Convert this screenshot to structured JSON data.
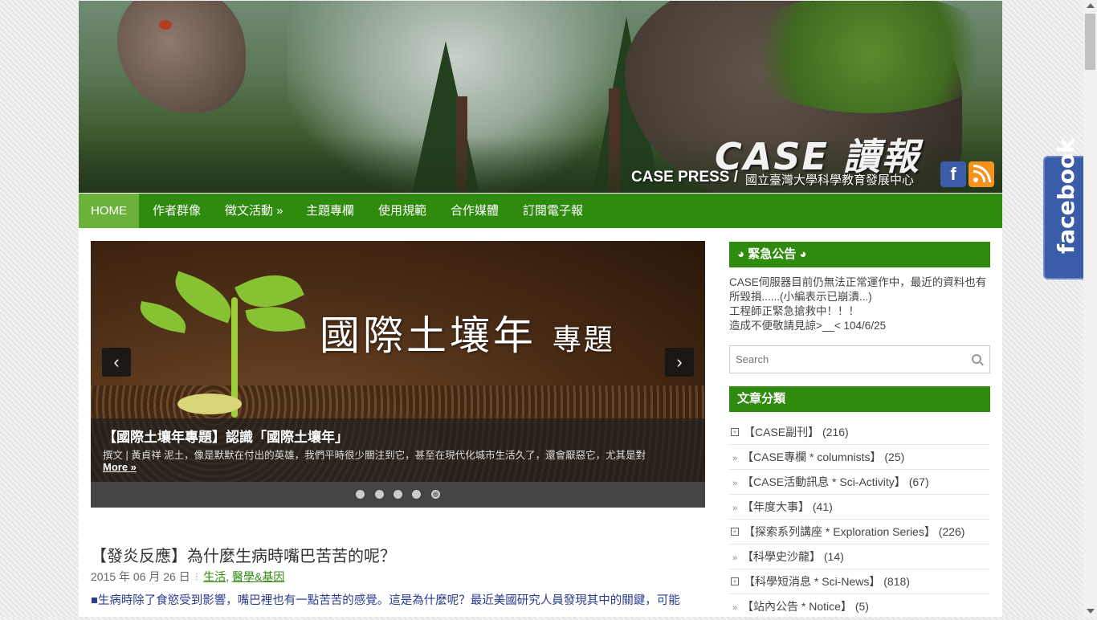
{
  "header": {
    "logo_main": "CASE 讀報",
    "logo_sub": "CASE PRESS /",
    "logo_org": "國立臺灣大學科學教育發展中心",
    "facebook_glyph": "f",
    "icons": [
      "facebook-icon",
      "rss-icon"
    ]
  },
  "nav": {
    "items": [
      {
        "label": "HOME"
      },
      {
        "label": "作者群像"
      },
      {
        "label": "徵文活動 »"
      },
      {
        "label": "主題專欄"
      },
      {
        "label": "使用規範"
      },
      {
        "label": "合作媒體"
      },
      {
        "label": "訂閱電子報"
      }
    ]
  },
  "slider": {
    "banner_text": "國際土壤年",
    "banner_text_small": "專題",
    "prev": "‹",
    "next": "›",
    "caption_title": "【國際土壤年專題】認識「國際土壤年」",
    "caption_text": "撰文 | 黃貞祥 泥土，像是默默在付出的英雄，我們平時很少關注到它，甚至在現代化城市生活久了，還會厭惡它，尤其是對",
    "more": "More »",
    "dots": 5
  },
  "post": {
    "title": "【發炎反應】為什麼生病時嘴巴苦苦的呢？",
    "date": "2015 年 06 月 26 日",
    "cat1": "生活",
    "cat2": "醫學&基因",
    "excerpt": "■生病時除了食慾受到影響，嘴巴裡也有一點苦苦的感覺。這是為什麼呢？最近美國研究人員發現其中的關鍵，可能"
  },
  "sidebar": {
    "notice_title": "◕ 緊急公告 ◕",
    "notice_lines": [
      "CASE伺服器目前仍無法正常運作中，最近的資料也有所毀損......(小編表示已崩潰...)",
      "工程師正緊急搶救中！！！",
      "造成不便敬請見諒>__< 104/6/25"
    ],
    "search_placeholder": "Search",
    "categories_title": "文章分類",
    "categories": [
      {
        "label": "【CASE副刊】",
        "count": "(216)",
        "expandable": true
      },
      {
        "label": "【CASE專欄 * columnists】",
        "count": "(25)",
        "expandable": false
      },
      {
        "label": "【CASE活動訊息 * Sci-Activity】",
        "count": "(67)",
        "expandable": false
      },
      {
        "label": "【年度大事】",
        "count": "(41)",
        "expandable": false
      },
      {
        "label": "【探索系列講座 * Exploration Series】",
        "count": "(226)",
        "expandable": true
      },
      {
        "label": "【科學史沙龍】",
        "count": "(14)",
        "expandable": false
      },
      {
        "label": "【科學短消息 * Sci-News】",
        "count": "(818)",
        "expandable": true
      },
      {
        "label": "【站內公告 * Notice】",
        "count": "(5)",
        "expandable": false
      }
    ]
  },
  "facebook_tab": {
    "label": "facebook"
  },
  "colors": {
    "nav_green": "#2e8b0e",
    "nav_active": "#6bb23a",
    "facebook_blue": "#3b5ca8",
    "rss_orange": "#f7921e"
  }
}
